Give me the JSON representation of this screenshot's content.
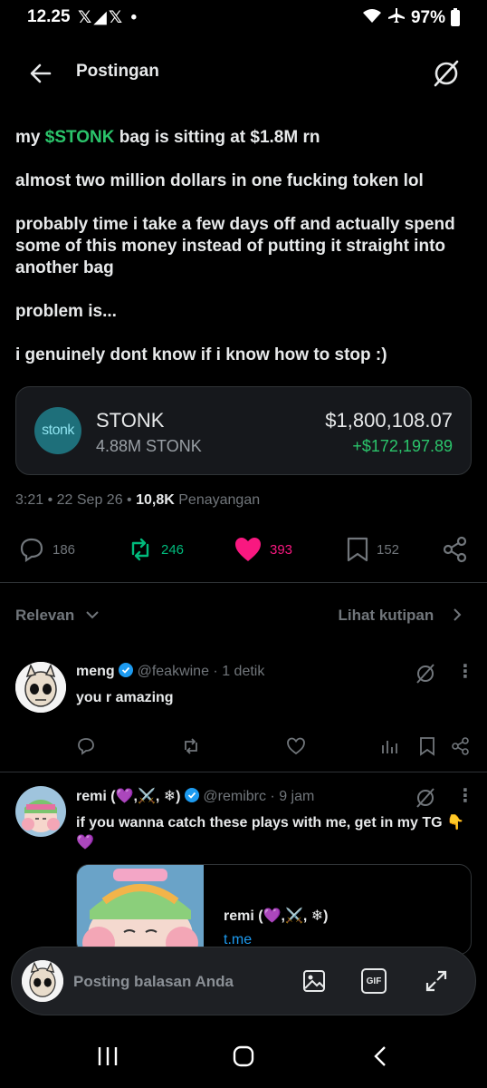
{
  "status": {
    "time": "12.25",
    "notif_icons": "𝕏◢𝕏 •",
    "battery": "97%"
  },
  "header": {
    "title": "Postingan"
  },
  "post": {
    "line1_pre": "my ",
    "cashtag": "$STONK",
    "line1_post": " bag is sitting at $1.8M rn",
    "p2": "almost two million dollars in one fucking token lol",
    "p3": "probably time i take a few days off and actually spend some of this money instead of putting it straight into another bag",
    "p4": "problem is...",
    "p5": "i genuinely dont know if i know how to stop :)"
  },
  "token": {
    "logo_text": "stonk",
    "name": "STONK",
    "amount": "4.88M STONK",
    "value": "$1,800,108.07",
    "change": "+$172,197.89",
    "colors": {
      "positive": "#2bc46b"
    }
  },
  "meta": {
    "time": "3:21",
    "date": "22 Sep 26",
    "views": "10,8K",
    "views_label": "Penayangan"
  },
  "actions": {
    "replies": "186",
    "reposts": "246",
    "likes": "393",
    "bookmarks": "152",
    "colors": {
      "repost": "#00ba7c",
      "like": "#f91880"
    }
  },
  "filter": {
    "sort": "Relevan",
    "quotes": "Lihat kutipan"
  },
  "replies": [
    {
      "name": "meng",
      "handle": "@feakwine",
      "time": "· 1 detik",
      "text": "you r amazing"
    },
    {
      "name": "remi (💜,⚔️, ❄)",
      "handle": "@remibrc",
      "time": "· 9 jam",
      "text": "if you wanna catch these plays with me, get in my TG 👇💜",
      "card": {
        "title": "remi (💜,⚔️, ❄)",
        "url": "t.me"
      }
    }
  ],
  "composer": {
    "placeholder": "Posting balasan Anda",
    "gif": "GIF"
  }
}
